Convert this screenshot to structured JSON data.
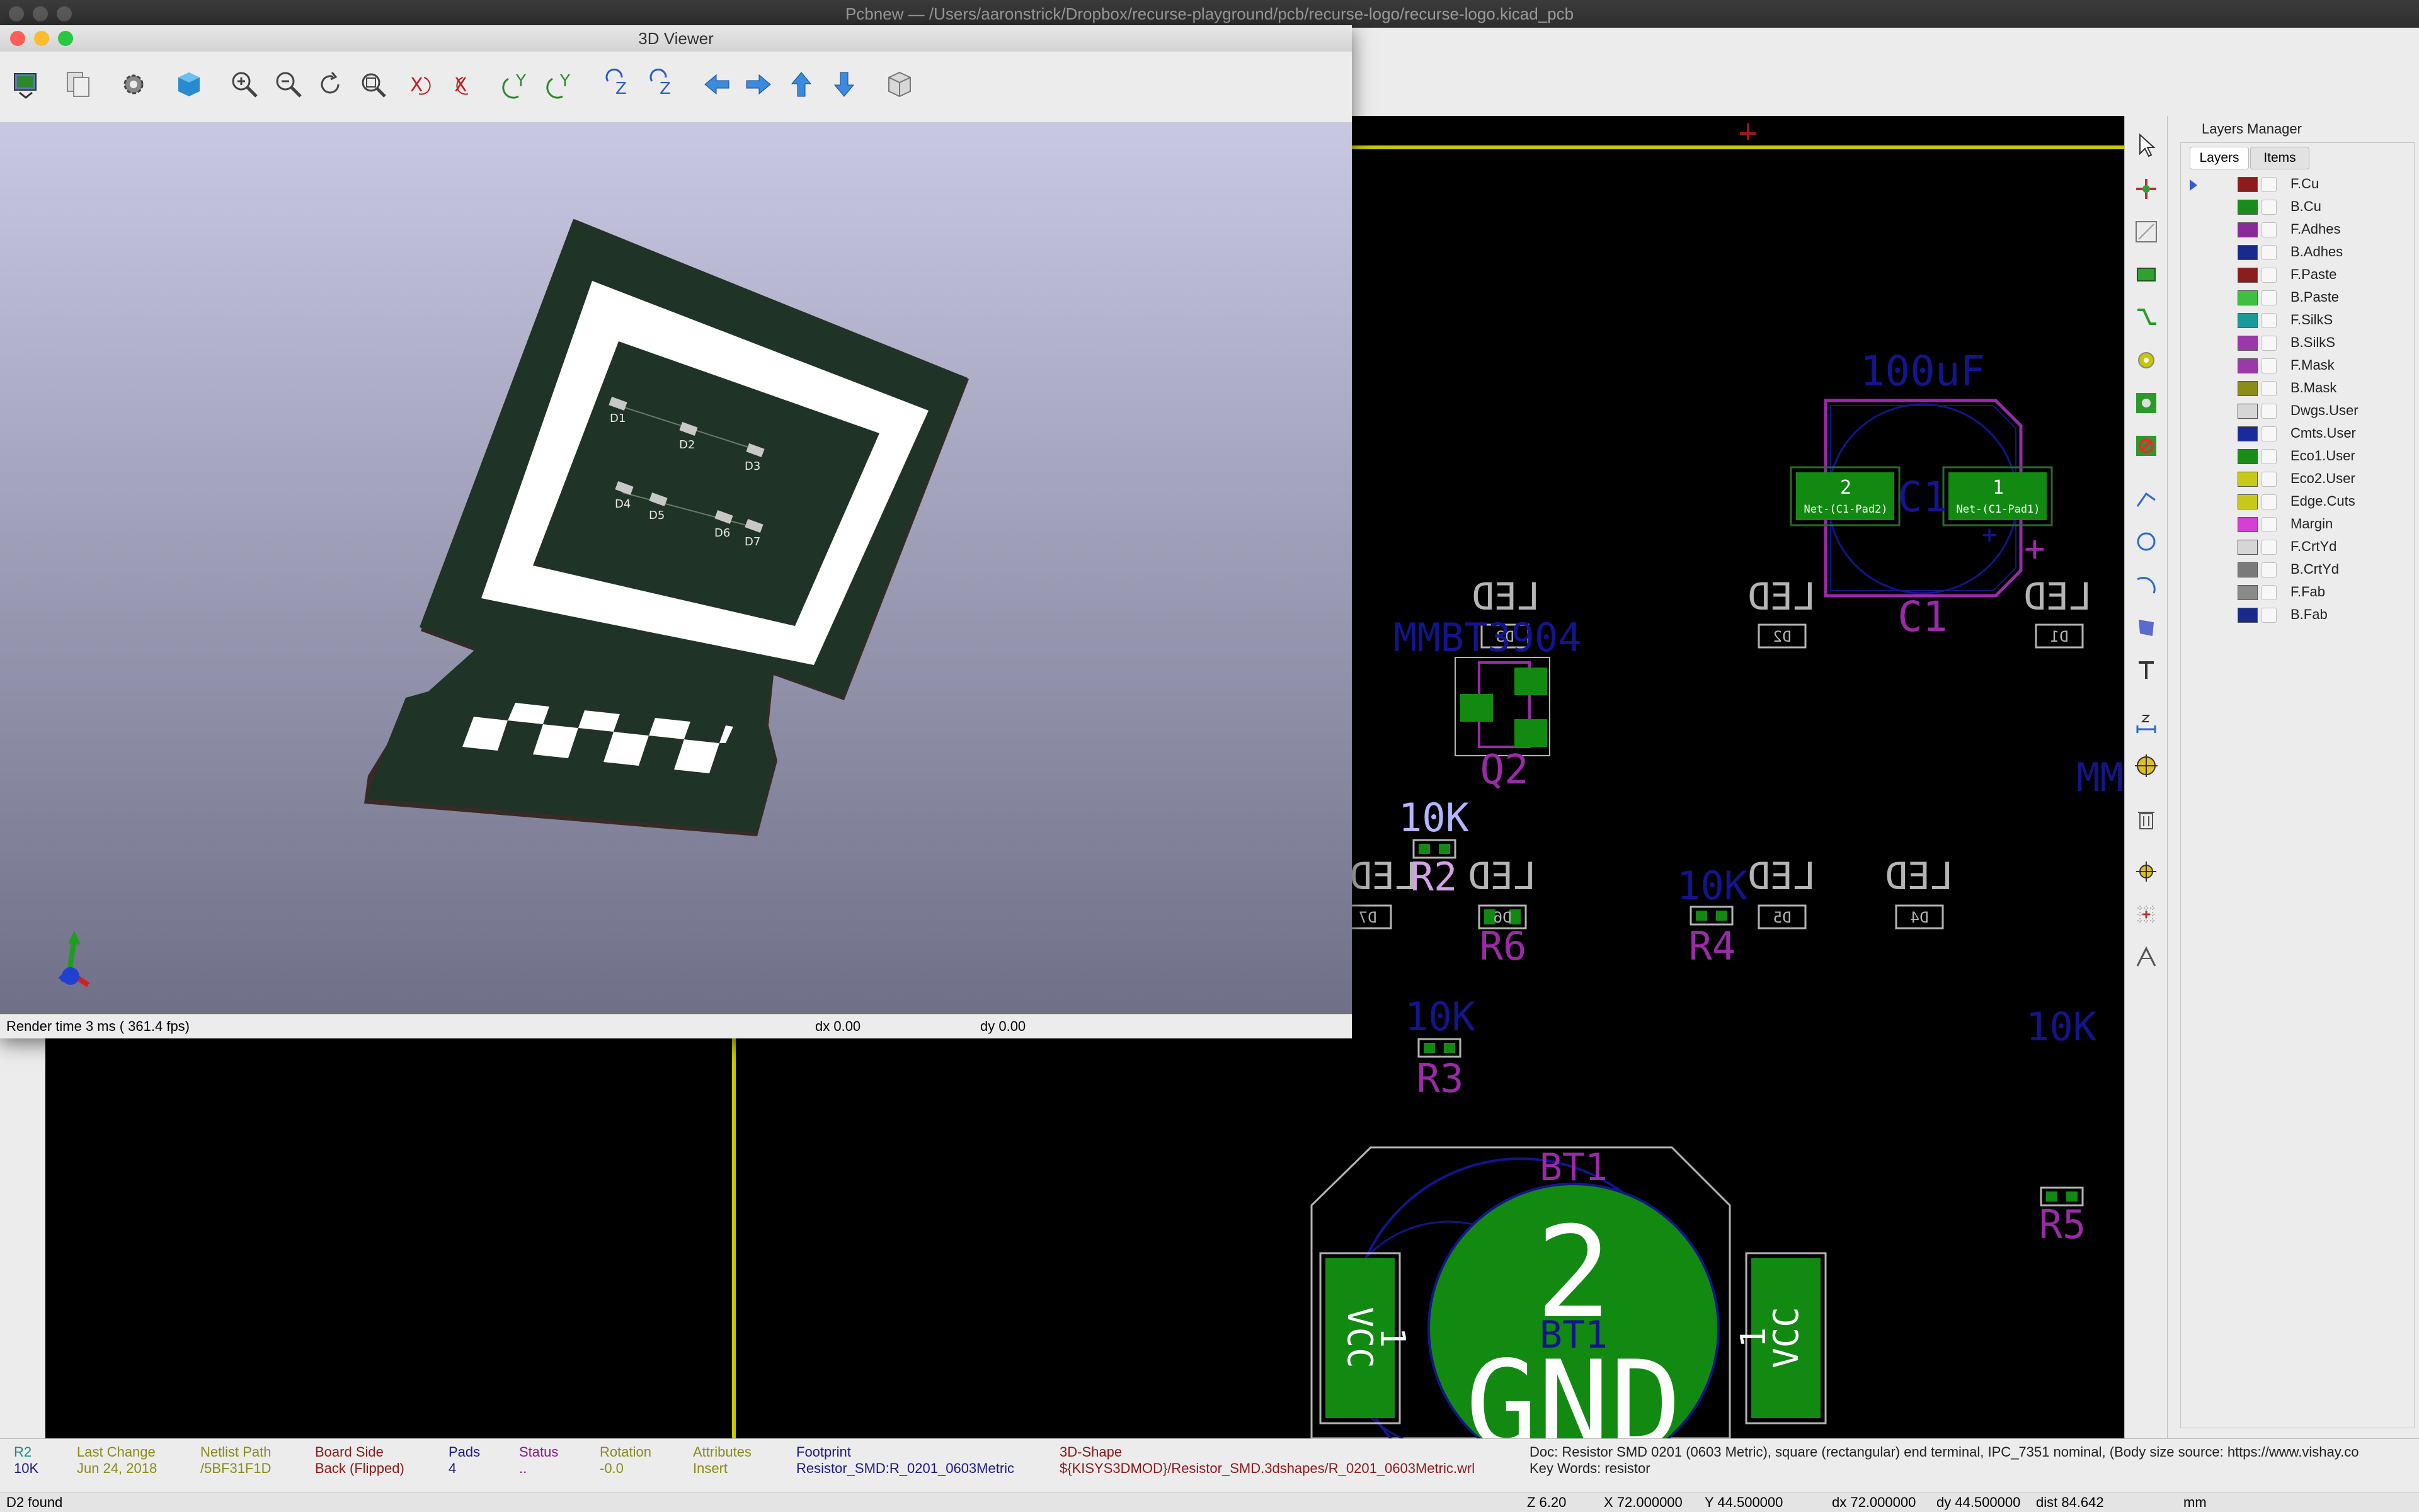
{
  "main_window": {
    "title": "Pcbnew — /Users/aaronstrick/Dropbox/recurse-playground/pcb/recurse-logo/recurse-logo.kicad_pcb"
  },
  "viewer": {
    "title": "3D Viewer",
    "toolbar_icons": [
      "reload-board-icon",
      "copy-image-icon",
      "preferences-icon",
      "render-3d-icon",
      "zoom-in-icon",
      "zoom-out-icon",
      "refresh-icon",
      "zoom-fit-icon",
      "rotate-x-cw-icon",
      "rotate-x-ccw-icon",
      "rotate-y-cw-icon",
      "rotate-y-ccw-icon",
      "rotate-z-cw-icon",
      "rotate-z-ccw-icon",
      "move-left-icon",
      "move-right-icon",
      "move-up-icon",
      "move-down-icon",
      "ortho-view-icon"
    ],
    "render_time": "Render time 3 ms ( 361.4 fps)",
    "dx": "dx 0.00",
    "dy": "dy 0.00",
    "board_refs": [
      "D1",
      "D2",
      "D3",
      "D4",
      "D5",
      "D6",
      "D7"
    ]
  },
  "pcb": {
    "labels": {
      "cap_value": "100uF",
      "cap_ref": "C1",
      "cap_pad2_num": "2",
      "cap_pad2_net": "Net-(C1-Pad2)",
      "cap_pad1_num": "1",
      "cap_pad1_net": "Net-(C1-Pad1)",
      "plus": "+",
      "led": "LED",
      "d3": "D3",
      "d2": "D2",
      "d1": "D1",
      "d6": "D6",
      "d5": "D5",
      "d4": "D4",
      "d7": "D7",
      "mmbt": "MMBT3904",
      "q2": "Q2",
      "r2_value": "10K",
      "r2_ref": "R2",
      "r6_ref": "R6",
      "r4_value": "10K",
      "r4_ref": "R4",
      "r3_value": "10K",
      "r3_ref": "R3",
      "right_value": "10K",
      "r5_ref": "R5",
      "mm_partial": "MM",
      "bt1": "BT1",
      "bt_pad_num": "2",
      "gnd": "GND",
      "vcc": "VCC",
      "pad1": "1"
    }
  },
  "layers_panel": {
    "title": "Layers Manager",
    "tabs": [
      "Layers",
      "Items"
    ],
    "layers": [
      {
        "name": "F.Cu",
        "color": "#8c1d1d"
      },
      {
        "name": "B.Cu",
        "color": "#1a8c1a"
      },
      {
        "name": "F.Adhes",
        "color": "#8a2a9a"
      },
      {
        "name": "B.Adhes",
        "color": "#1a2a8c"
      },
      {
        "name": "F.Paste",
        "color": "#8c1d1d"
      },
      {
        "name": "B.Paste",
        "color": "#3fbf3f"
      },
      {
        "name": "F.SilkS",
        "color": "#1a9a9a"
      },
      {
        "name": "B.SilkS",
        "color": "#9a3aa8"
      },
      {
        "name": "F.Mask",
        "color": "#9a3aa8"
      },
      {
        "name": "B.Mask",
        "color": "#8c8c1a"
      },
      {
        "name": "Dwgs.User",
        "color": "#d6d6d6"
      },
      {
        "name": "Cmts.User",
        "color": "#1a2a9a"
      },
      {
        "name": "Eco1.User",
        "color": "#1a8c1a"
      },
      {
        "name": "Eco2.User",
        "color": "#c8c81a"
      },
      {
        "name": "Edge.Cuts",
        "color": "#c8c81a"
      },
      {
        "name": "Margin",
        "color": "#d63fd6"
      },
      {
        "name": "F.CrtYd",
        "color": "#d6d6d6"
      },
      {
        "name": "B.CrtYd",
        "color": "#7a7a7a"
      },
      {
        "name": "F.Fab",
        "color": "#8a8a8a"
      },
      {
        "name": "B.Fab",
        "color": "#1a2a8c"
      }
    ]
  },
  "right_toolbar_icons": [
    "select-arrow-icon",
    "highlight-net-icon",
    "local-ratsnest-icon",
    "footprint-icon",
    "route-track-icon",
    "add-via-icon",
    "add-zone-icon",
    "keepout-icon",
    "add-line-icon",
    "add-circle-icon",
    "add-arc-icon",
    "add-polygon-icon",
    "add-text-icon",
    "dimension-icon",
    "target-icon",
    "delete-icon",
    "place-origin-icon",
    "grid-origin-icon",
    "measure-icon"
  ],
  "message_panel": {
    "ref_label": "R2",
    "ref_value": "10K",
    "last_change_label": "Last Change",
    "last_change_value": "Jun 24, 2018",
    "netlist_label": "Netlist Path",
    "netlist_value": "/5BF31F1D",
    "board_side_label": "Board Side",
    "board_side_value": "Back (Flipped)",
    "pads_label": "Pads",
    "pads_value": "4",
    "status_label": "Status",
    "status_value": "..",
    "rotation_label": "Rotation",
    "rotation_value": "-0.0",
    "attributes_label": "Attributes",
    "attributes_value": "Insert",
    "footprint_label": "Footprint",
    "footprint_value": "Resistor_SMD:R_0201_0603Metric",
    "shape_label": "3D-Shape",
    "shape_value": "${KISYS3DMOD}/Resistor_SMD.3dshapes/R_0201_0603Metric.wrl",
    "doc_text": "Doc: Resistor SMD 0201 (0603 Metric), square (rectangular) end terminal, IPC_7351 nominal, (Body size source: https://www.vishay.co",
    "keywords_text": "Key Words: resistor"
  },
  "status_bar": {
    "found": "D2 found",
    "zoom": "Z 6.20",
    "x": "X 72.000000",
    "y": "Y 44.500000",
    "dx": "dx 72.000000",
    "dy": "dy 44.500000",
    "dist": "dist 84.642",
    "units": "mm"
  },
  "colors": {
    "silk_gray": "#b4b4b4",
    "fab_blue": "#14148c",
    "purple": "#9a2aa8",
    "pad_green": "#128a12",
    "edge_yellow": "#c8c800",
    "cu_red": "#a01818"
  }
}
